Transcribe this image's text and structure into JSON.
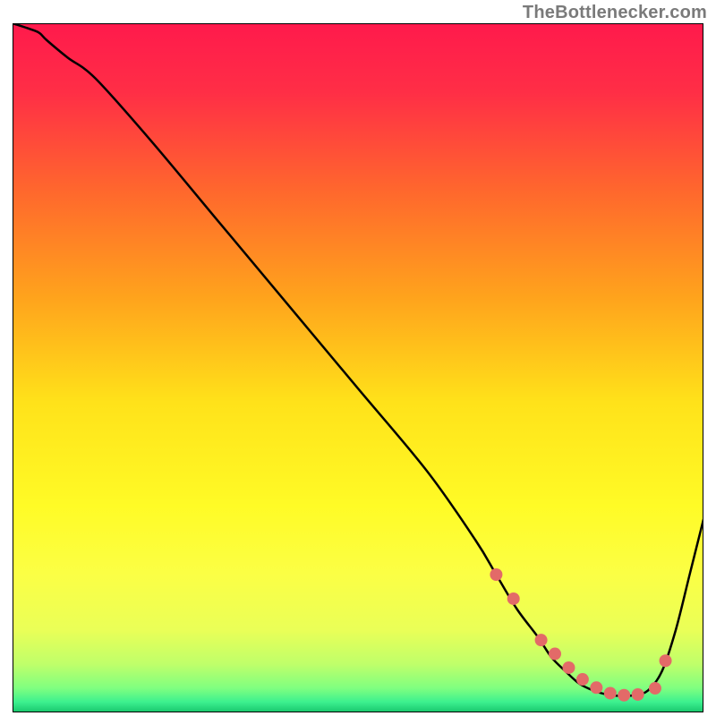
{
  "attribution": "TheBottlenecker.com",
  "chart_data": {
    "type": "line",
    "title": "",
    "xlabel": "",
    "ylabel": "",
    "xlim": [
      0,
      100
    ],
    "ylim": [
      0,
      100
    ],
    "background_gradient": {
      "stops": [
        {
          "offset": 0.0,
          "color": "#ff1a4c"
        },
        {
          "offset": 0.1,
          "color": "#ff2e46"
        },
        {
          "offset": 0.25,
          "color": "#ff6a2c"
        },
        {
          "offset": 0.4,
          "color": "#ffa41c"
        },
        {
          "offset": 0.55,
          "color": "#ffe21a"
        },
        {
          "offset": 0.7,
          "color": "#fffb26"
        },
        {
          "offset": 0.8,
          "color": "#fbff45"
        },
        {
          "offset": 0.88,
          "color": "#eaff57"
        },
        {
          "offset": 0.93,
          "color": "#bfff6a"
        },
        {
          "offset": 0.965,
          "color": "#7fff80"
        },
        {
          "offset": 0.985,
          "color": "#3cf08f"
        },
        {
          "offset": 1.0,
          "color": "#18c66c"
        }
      ]
    },
    "series": [
      {
        "name": "curve",
        "x": [
          0,
          3,
          4,
          5,
          8,
          12,
          20,
          30,
          40,
          50,
          60,
          67,
          70,
          73,
          76,
          78,
          80,
          82,
          84,
          86,
          88,
          90,
          92,
          94,
          96,
          98,
          100
        ],
        "y": [
          100,
          99,
          98.5,
          97.5,
          95,
          92,
          83,
          71,
          59,
          47,
          35,
          25,
          20,
          15,
          11,
          8,
          6,
          4.2,
          3.2,
          2.6,
          2.4,
          2.5,
          3.2,
          6,
          12,
          20,
          28
        ]
      }
    ],
    "markers": {
      "name": "dots",
      "x": [
        70,
        72.5,
        76.5,
        78.5,
        80.5,
        82.5,
        84.5,
        86.5,
        88.5,
        90.5,
        93.0,
        94.5
      ],
      "y": [
        20,
        16.5,
        10.5,
        8.5,
        6.5,
        4.8,
        3.6,
        2.8,
        2.5,
        2.6,
        3.5,
        7.5
      ],
      "color": "#e36a68",
      "radius_px": 7
    }
  }
}
